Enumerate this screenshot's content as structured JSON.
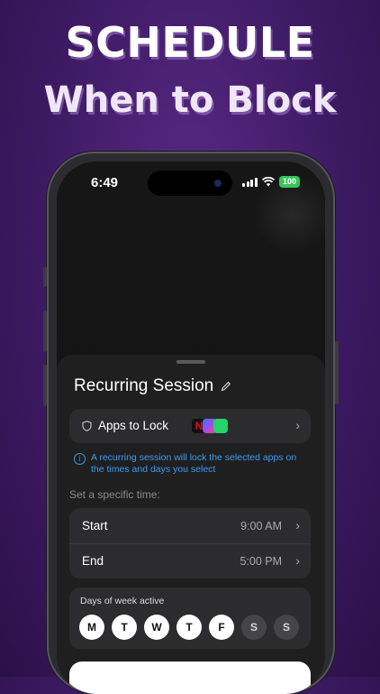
{
  "headline": {
    "line1": "SCHEDULE",
    "line2": "When to Block"
  },
  "status_bar": {
    "time": "6:49",
    "battery": "100"
  },
  "sheet": {
    "title": "Recurring Session",
    "apps_row": {
      "label": "Apps to Lock",
      "app_icons": [
        "netflix-icon",
        "messenger-icon",
        "whatsapp-icon"
      ]
    },
    "info_text": "A recurring session will lock the selected apps on the times and days you select",
    "time_section_label": "Set a specific time:",
    "times": [
      {
        "label": "Start",
        "value": "9:00 AM"
      },
      {
        "label": "End",
        "value": "5:00 PM"
      }
    ],
    "days_label": "Days of week active",
    "days": [
      {
        "letter": "M",
        "active": true
      },
      {
        "letter": "T",
        "active": true
      },
      {
        "letter": "W",
        "active": true
      },
      {
        "letter": "T",
        "active": true
      },
      {
        "letter": "F",
        "active": true
      },
      {
        "letter": "S",
        "active": false
      },
      {
        "letter": "S",
        "active": false
      }
    ]
  },
  "colors": {
    "accent_blue": "#3d9bf0",
    "battery_green": "#34c759",
    "background_purple": "#3d1a63"
  }
}
